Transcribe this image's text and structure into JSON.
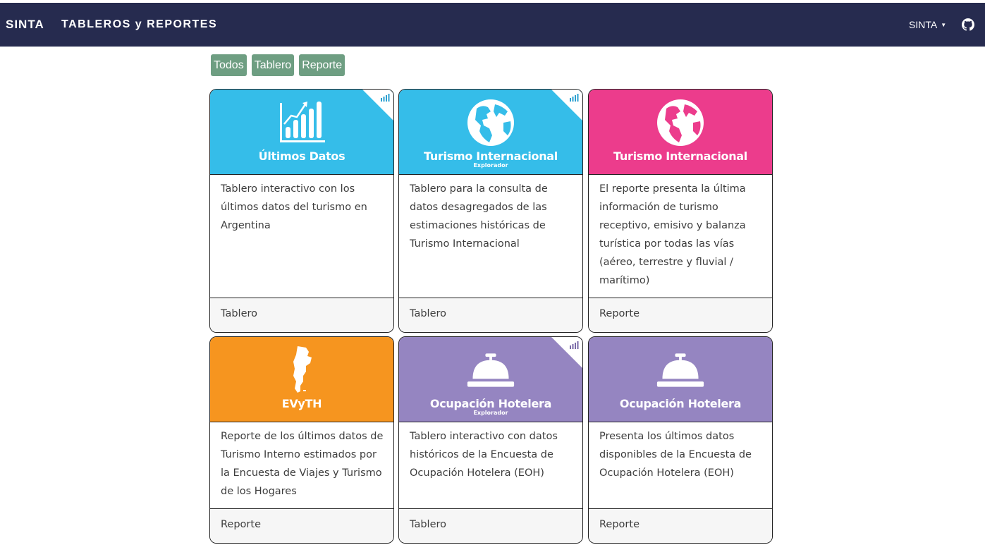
{
  "navbar": {
    "brand": "SINTA",
    "title": "TABLEROS y REPORTES",
    "user_menu": "SINTA",
    "github_icon": "github-icon"
  },
  "filters": [
    "Todos",
    "Tablero",
    "Reporte"
  ],
  "colors": {
    "navbar": "#262b4f",
    "filter_button": "#6e9e82",
    "blue": "#35bde9",
    "pink": "#ec3c8c",
    "orange": "#f6951f",
    "purple": "#9585c1"
  },
  "cards": [
    {
      "title": "Últimos Datos",
      "subtitle": "",
      "icon": "bar-chart-icon",
      "description": "Tablero interactivo con los últimos datos del turismo en Argentina",
      "type": "Tablero",
      "corner_badge": "dashboard-badge-icon"
    },
    {
      "title": "Turismo Internacional",
      "subtitle": "Explorador",
      "icon": "globe-icon",
      "description": "Tablero para la consulta de datos desagregados de las estimaciones históricas de Turismo Internacional",
      "type": "Tablero",
      "corner_badge": "dashboard-badge-icon"
    },
    {
      "title": "Turismo Internacional",
      "subtitle": "",
      "icon": "globe-icon",
      "description": "El reporte presenta la última información de turismo receptivo, emisivo y balanza turística por todas las vías (aéreo, terrestre y fluvial / marítimo)",
      "type": "Reporte"
    },
    {
      "title": "EVyTH",
      "subtitle": "",
      "icon": "argentina-map-icon",
      "description": "Reporte de los últimos datos de Turismo Interno estimados por la Encuesta de Viajes y Turismo de los Hogares",
      "type": "Reporte"
    },
    {
      "title": "Ocupación Hotelera",
      "subtitle": "Explorador",
      "icon": "service-bell-icon",
      "description": "Tablero interactivo con datos históricos de la Encuesta de Ocupación Hotelera (EOH)",
      "type": "Tablero",
      "corner_badge": "dashboard-badge-icon"
    },
    {
      "title": "Ocupación Hotelera",
      "subtitle": "",
      "icon": "service-bell-icon",
      "description": "Presenta los últimos datos disponibles de la Encuesta de Ocupación Hotelera (EOH)",
      "type": "Reporte"
    }
  ]
}
